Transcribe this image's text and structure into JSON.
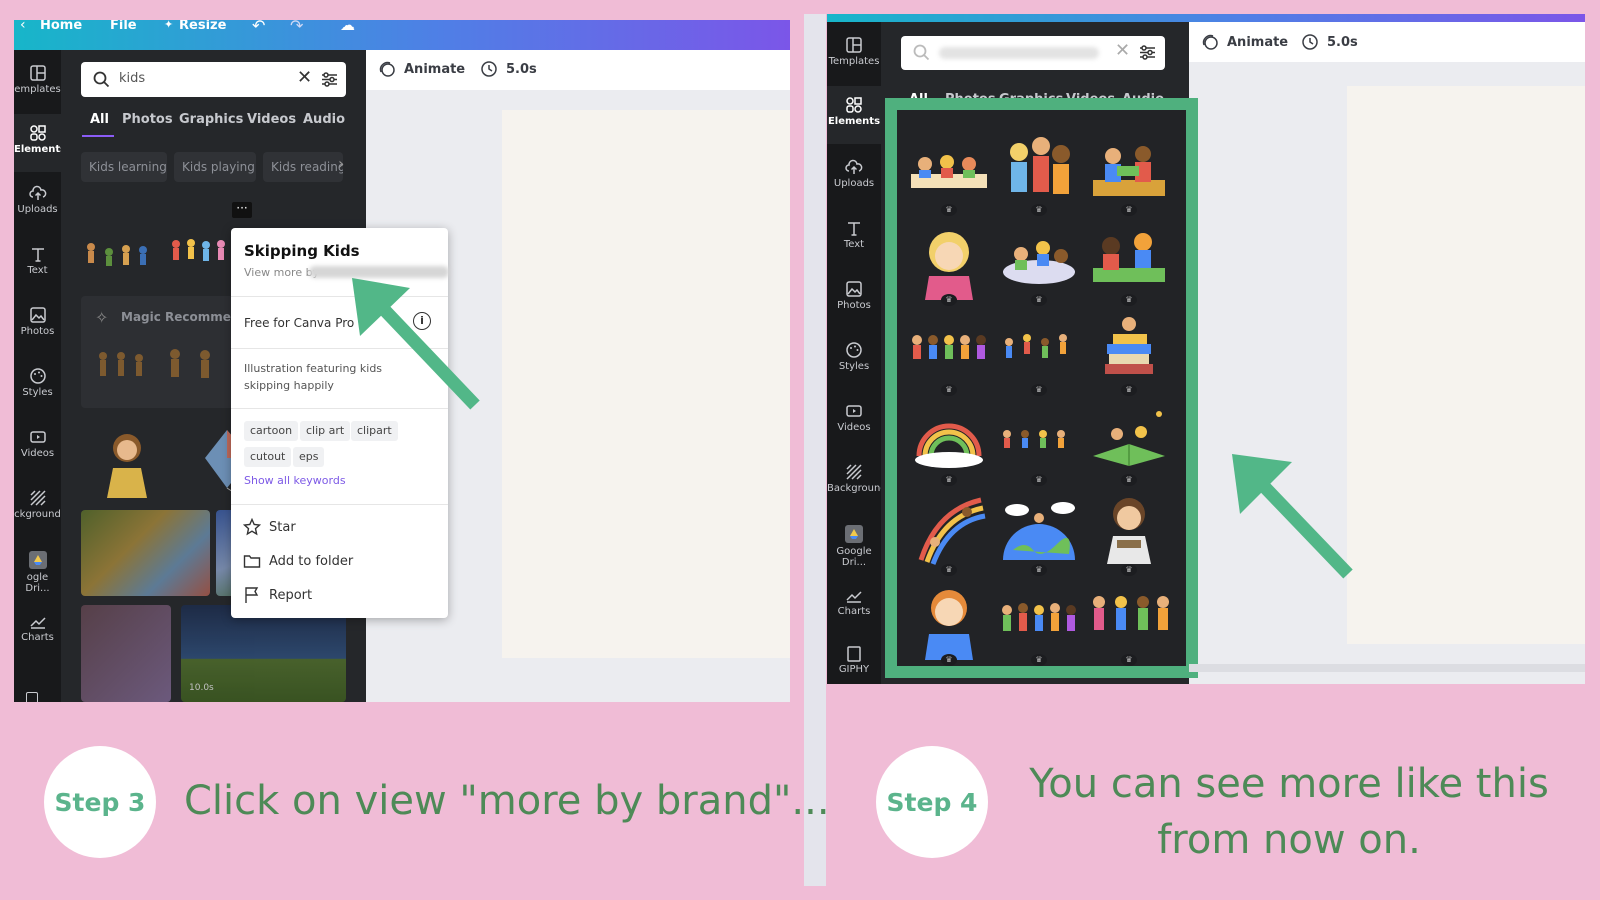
{
  "left": {
    "topbar": {
      "home": "Home",
      "file": "File",
      "resize": "Resize"
    },
    "rail": [
      "emplates",
      "Elements",
      "Uploads",
      "Text",
      "Photos",
      "Styles",
      "Videos",
      "ckground",
      "ogle Dri...",
      "Charts"
    ],
    "search": {
      "value": "kids"
    },
    "tabs": [
      "All",
      "Photos",
      "Graphics",
      "Videos",
      "Audio"
    ],
    "chips": [
      "Kids learning",
      "Kids playing",
      "Kids reading"
    ],
    "section_label": "Magic Recommend",
    "video_badge": "10.0s",
    "toolbar": {
      "animate": "Animate",
      "duration": "5.0s"
    },
    "menu": {
      "title": "Skipping Kids",
      "view_more": "View more by",
      "license": "Free for Canva Pro",
      "description": "Illustration featuring kids skipping happily",
      "keywords": [
        "cartoon",
        "clip art",
        "clipart",
        "cutout",
        "eps"
      ],
      "show_all": "Show all keywords",
      "star": "Star",
      "add_folder": "Add to folder",
      "report": "Report"
    }
  },
  "right": {
    "rail": [
      "Templates",
      "Elements",
      "Uploads",
      "Text",
      "Photos",
      "Styles",
      "Videos",
      "Background",
      "Google Dri...",
      "Charts",
      "GIPHY"
    ],
    "tabs": [
      "All",
      "Photos",
      "Graphics",
      "Videos",
      "Audio"
    ],
    "toolbar": {
      "animate": "Animate",
      "duration": "5.0s"
    }
  },
  "steps": [
    {
      "label": "Step 3",
      "text": "Click on view \"more by brand\"..."
    },
    {
      "label": "Step 4",
      "text": "You can see more like this from now on."
    }
  ],
  "colors": {
    "background": "#f0bcd6",
    "arrow": "#52b788",
    "highlight": "#4fb07e",
    "step_text": "#4e8a57"
  }
}
